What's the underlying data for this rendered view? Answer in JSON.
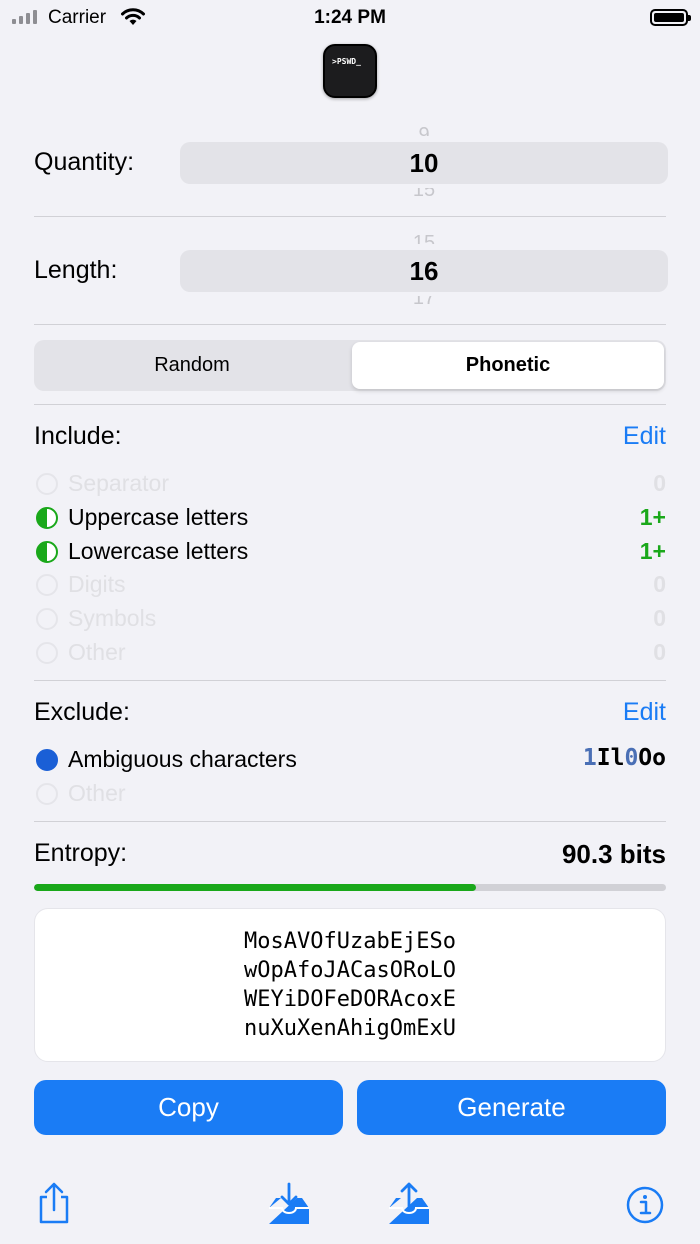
{
  "status": {
    "carrier": "Carrier",
    "time": "1:24 PM"
  },
  "app_icon": {
    "text": ">PSWD_"
  },
  "quantity": {
    "label": "Quantity:",
    "value": "10",
    "prev": "9",
    "next": "15"
  },
  "length": {
    "label": "Length:",
    "value": "16",
    "prev": "15",
    "next": "17"
  },
  "mode": {
    "options": [
      "Random",
      "Phonetic"
    ],
    "selected": "Phonetic"
  },
  "include": {
    "title": "Include:",
    "edit": "Edit",
    "items": [
      {
        "label": "Separator",
        "count": "0",
        "state": "off"
      },
      {
        "label": "Uppercase letters",
        "count": "1+",
        "state": "half"
      },
      {
        "label": "Lowercase letters",
        "count": "1+",
        "state": "half"
      },
      {
        "label": "Digits",
        "count": "0",
        "state": "off"
      },
      {
        "label": "Symbols",
        "count": "0",
        "state": "off"
      },
      {
        "label": "Other",
        "count": "0",
        "state": "off"
      }
    ]
  },
  "exclude": {
    "title": "Exclude:",
    "edit": "Edit",
    "ambiguous_label": "Ambiguous characters",
    "ambiguous_sample_a": "1",
    "ambiguous_sample_b": "Il",
    "ambiguous_sample_c": "0",
    "ambiguous_sample_d": "Oo",
    "other_label": "Other"
  },
  "entropy": {
    "label": "Entropy:",
    "value": "90.3 bits",
    "fraction": 0.7
  },
  "passwords": [
    "MosAVOfUzabEjESo",
    "wOpAfoJACasORoLO",
    "WEYiDOFeDORAcoxE",
    "nuXuXenAhigOmExU"
  ],
  "buttons": {
    "copy": "Copy",
    "generate": "Generate"
  },
  "toolbar": [
    "share-icon",
    "download-tray-icon",
    "upload-tray-icon",
    "info-icon"
  ],
  "colors": {
    "accent": "#1a7cf5",
    "green": "#1aa81a",
    "selected_blue": "#1a5fd6"
  }
}
